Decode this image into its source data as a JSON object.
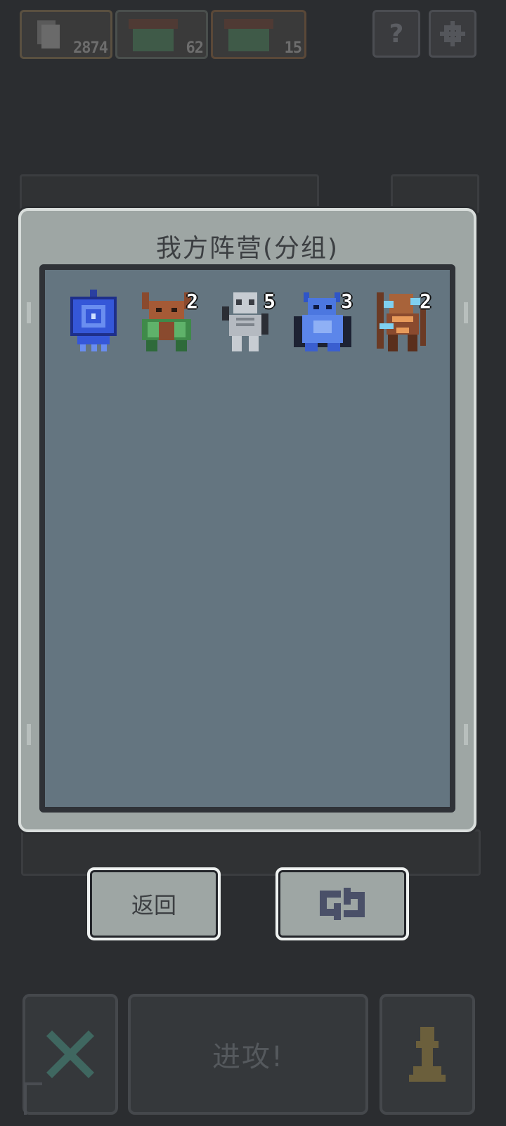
{
  "hud": {
    "resources": [
      {
        "icon": "card-icon",
        "value": "2874"
      },
      {
        "icon": "monster-icon",
        "value": "62"
      },
      {
        "icon": "monster-icon",
        "value": "15"
      }
    ],
    "help_label": "?",
    "settings_icon": "gear-icon"
  },
  "panel": {
    "title": "我方阵营(分组)",
    "units": [
      {
        "name": "blue-banner",
        "count": ""
      },
      {
        "name": "horned-beast",
        "count": "2"
      },
      {
        "name": "skeleton",
        "count": "5"
      },
      {
        "name": "blue-demon",
        "count": "3"
      },
      {
        "name": "archer",
        "count": "2"
      }
    ]
  },
  "buttons": {
    "back_label": "返回",
    "swap_icon": "swap-icon"
  },
  "bottom": {
    "cancel_icon": "close-icon",
    "attack_label": "进攻!",
    "pawn_icon": "pawn-icon"
  },
  "colors": {
    "panel_bg": "#9ea6a4",
    "panel_inner": "#647580",
    "page_bg": "#2b2d30"
  }
}
